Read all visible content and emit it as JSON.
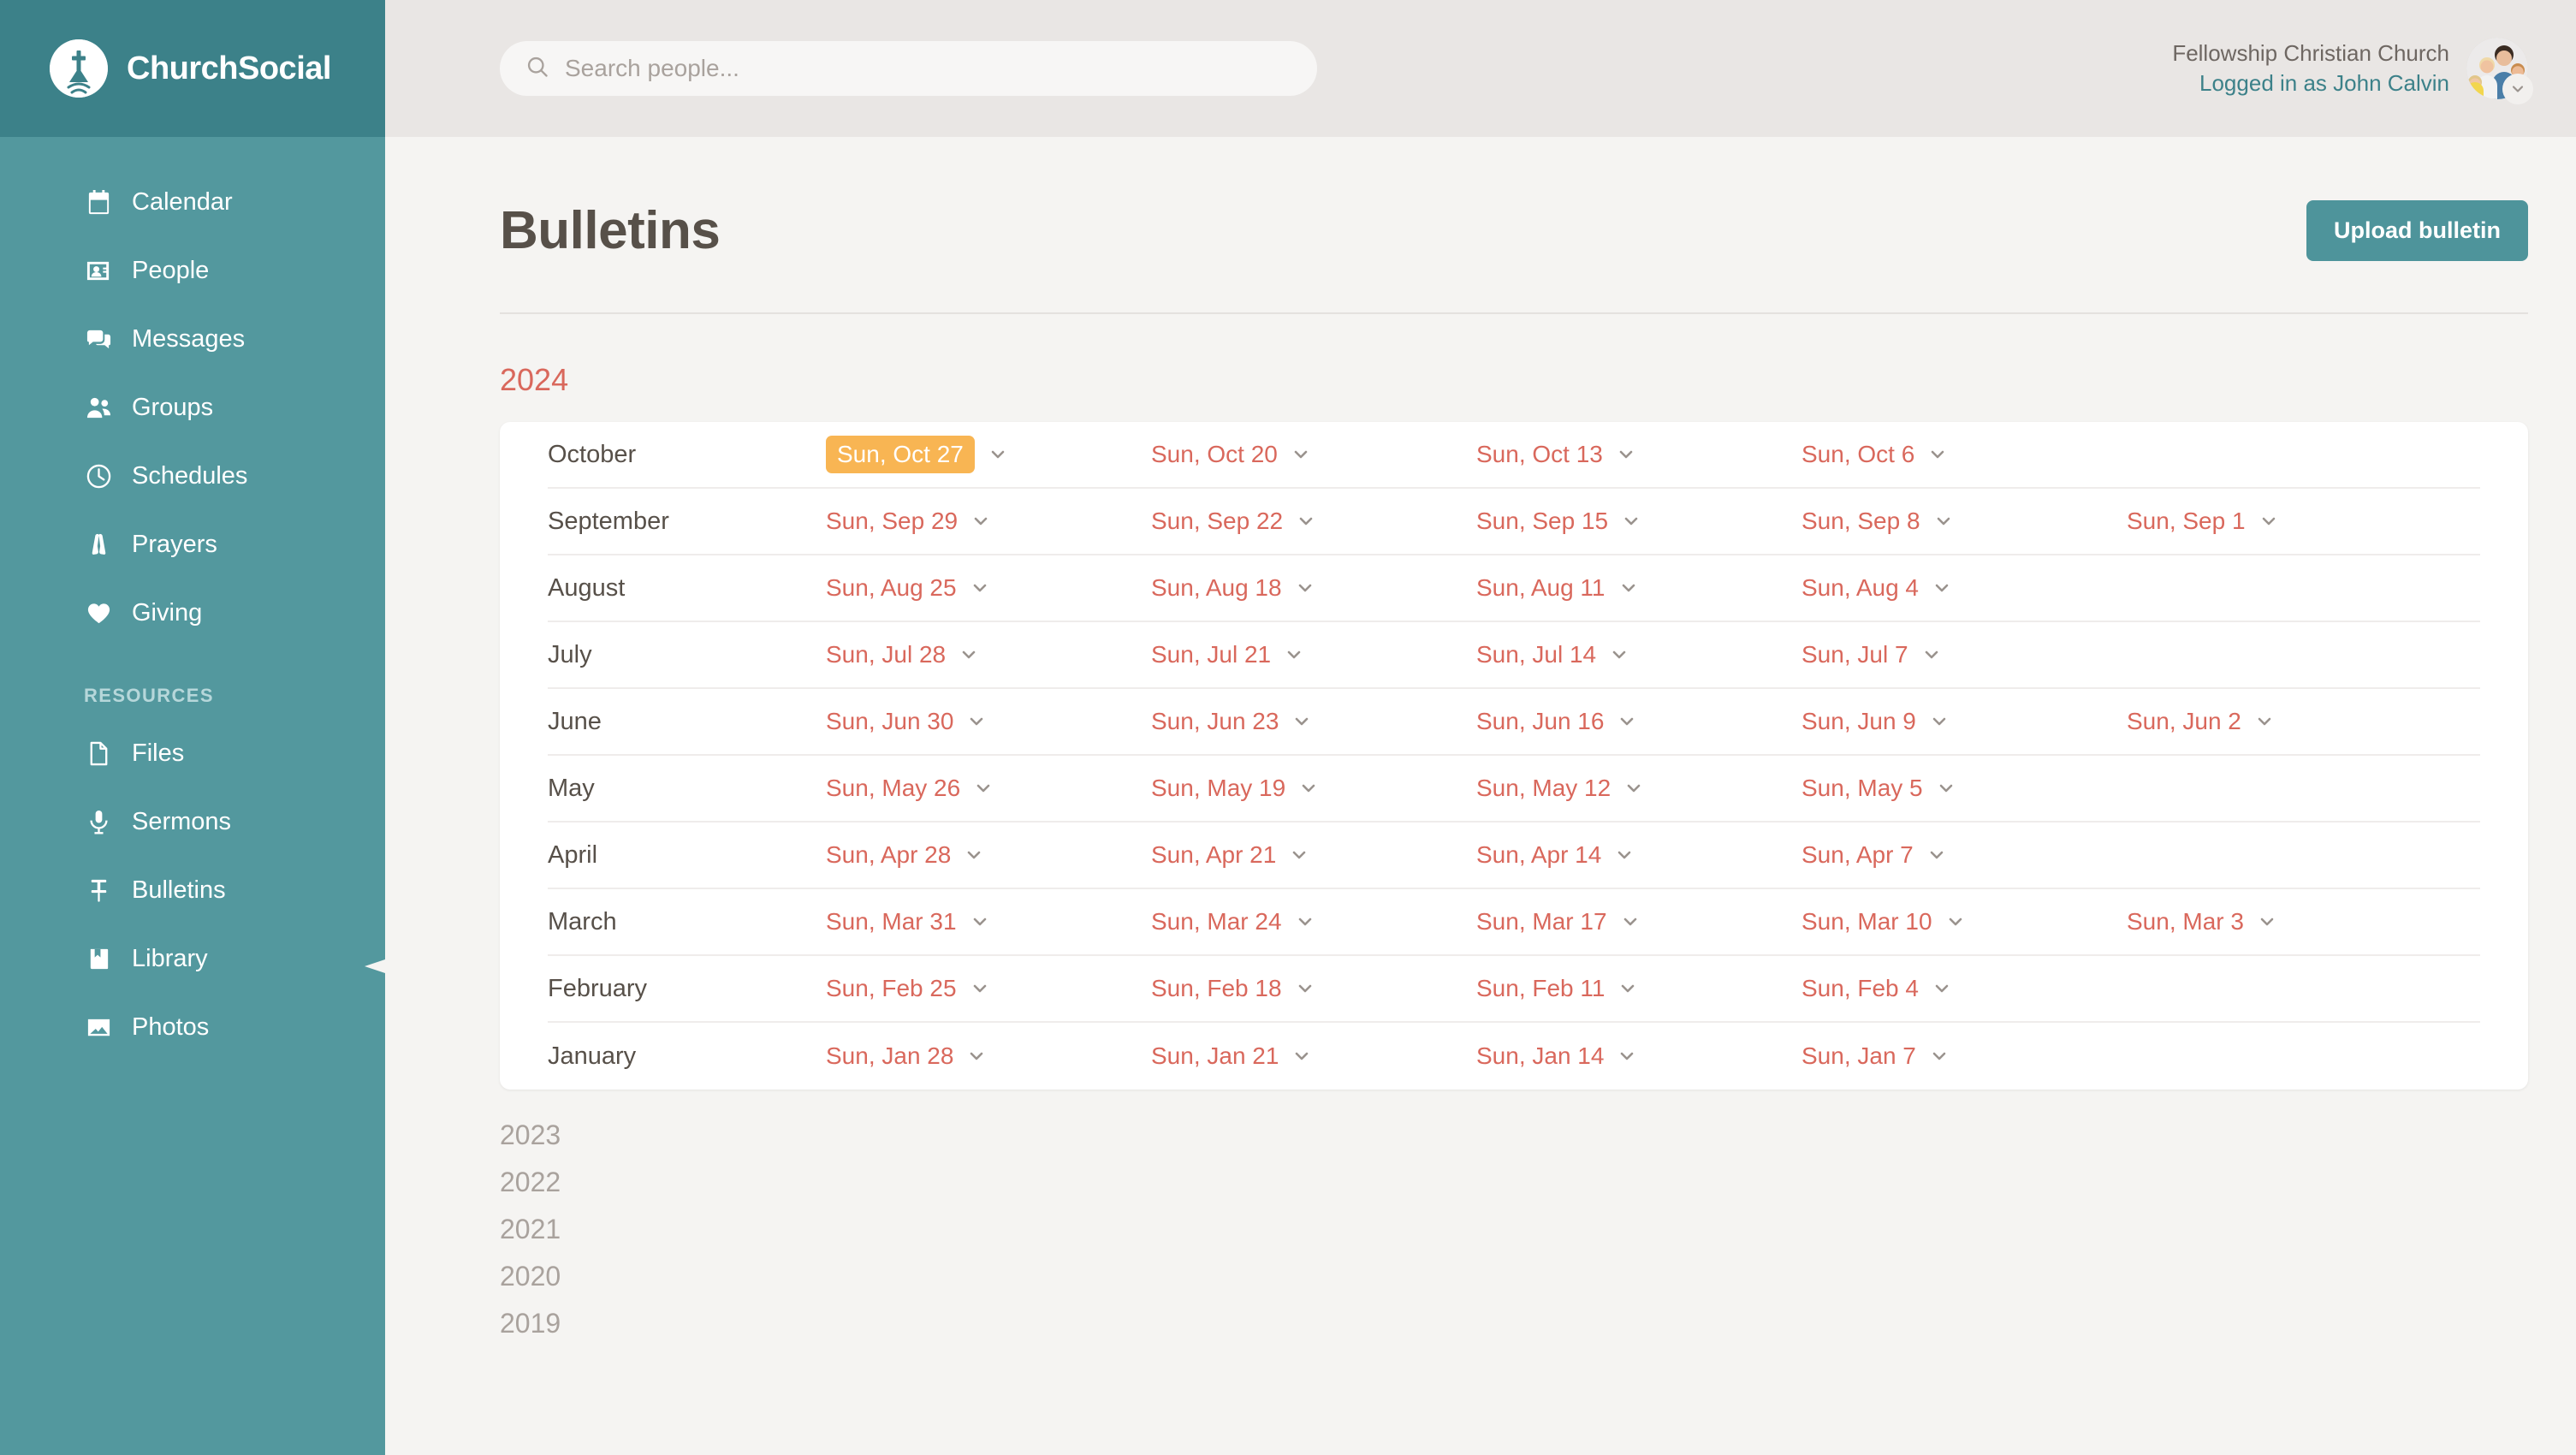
{
  "brand": {
    "name": "ChurchSocial",
    "logo_icon": "church-cross-logo-icon"
  },
  "sidebar": {
    "primary_items": [
      {
        "label": "Calendar",
        "icon": "calendar-icon"
      },
      {
        "label": "People",
        "icon": "people-card-icon"
      },
      {
        "label": "Messages",
        "icon": "messages-icon"
      },
      {
        "label": "Groups",
        "icon": "groups-icon"
      },
      {
        "label": "Schedules",
        "icon": "clock-icon"
      },
      {
        "label": "Prayers",
        "icon": "praying-hands-icon"
      },
      {
        "label": "Giving",
        "icon": "heart-icon"
      }
    ],
    "section_label": "RESOURCES",
    "resource_items": [
      {
        "label": "Files",
        "icon": "file-icon"
      },
      {
        "label": "Sermons",
        "icon": "microphone-icon"
      },
      {
        "label": "Bulletins",
        "icon": "pushpin-icon"
      },
      {
        "label": "Library",
        "icon": "book-icon"
      },
      {
        "label": "Photos",
        "icon": "photo-icon"
      }
    ],
    "active_item": "Bulletins"
  },
  "topbar": {
    "search_placeholder": "Search people...",
    "search_value": "",
    "search_icon": "search-icon",
    "church_name": "Fellowship Christian Church",
    "logged_in_as": "Logged in as John Calvin",
    "avatar_caret_icon": "chevron-down-icon"
  },
  "page": {
    "title": "Bulletins",
    "upload_label": "Upload bulletin"
  },
  "bulletins": {
    "current_year": "2024",
    "rows": [
      {
        "month": "October",
        "dates": [
          {
            "label": "Sun, Oct 27",
            "highlighted": true
          },
          {
            "label": "Sun, Oct 20"
          },
          {
            "label": "Sun, Oct 13"
          },
          {
            "label": "Sun, Oct 6"
          }
        ]
      },
      {
        "month": "September",
        "dates": [
          {
            "label": "Sun, Sep 29"
          },
          {
            "label": "Sun, Sep 22"
          },
          {
            "label": "Sun, Sep 15"
          },
          {
            "label": "Sun, Sep 8"
          },
          {
            "label": "Sun, Sep 1"
          }
        ]
      },
      {
        "month": "August",
        "dates": [
          {
            "label": "Sun, Aug 25"
          },
          {
            "label": "Sun, Aug 18"
          },
          {
            "label": "Sun, Aug 11"
          },
          {
            "label": "Sun, Aug 4"
          }
        ]
      },
      {
        "month": "July",
        "dates": [
          {
            "label": "Sun, Jul 28"
          },
          {
            "label": "Sun, Jul 21"
          },
          {
            "label": "Sun, Jul 14"
          },
          {
            "label": "Sun, Jul 7"
          }
        ]
      },
      {
        "month": "June",
        "dates": [
          {
            "label": "Sun, Jun 30"
          },
          {
            "label": "Sun, Jun 23"
          },
          {
            "label": "Sun, Jun 16"
          },
          {
            "label": "Sun, Jun 9"
          },
          {
            "label": "Sun, Jun 2"
          }
        ]
      },
      {
        "month": "May",
        "dates": [
          {
            "label": "Sun, May 26"
          },
          {
            "label": "Sun, May 19"
          },
          {
            "label": "Sun, May 12"
          },
          {
            "label": "Sun, May 5"
          }
        ]
      },
      {
        "month": "April",
        "dates": [
          {
            "label": "Sun, Apr 28"
          },
          {
            "label": "Sun, Apr 21"
          },
          {
            "label": "Sun, Apr 14"
          },
          {
            "label": "Sun, Apr 7"
          }
        ]
      },
      {
        "month": "March",
        "dates": [
          {
            "label": "Sun, Mar 31"
          },
          {
            "label": "Sun, Mar 24"
          },
          {
            "label": "Sun, Mar 17"
          },
          {
            "label": "Sun, Mar 10"
          },
          {
            "label": "Sun, Mar 3"
          }
        ]
      },
      {
        "month": "February",
        "dates": [
          {
            "label": "Sun, Feb 25"
          },
          {
            "label": "Sun, Feb 18"
          },
          {
            "label": "Sun, Feb 11"
          },
          {
            "label": "Sun, Feb 4"
          }
        ]
      },
      {
        "month": "January",
        "dates": [
          {
            "label": "Sun, Jan 28"
          },
          {
            "label": "Sun, Jan 21"
          },
          {
            "label": "Sun, Jan 14"
          },
          {
            "label": "Sun, Jan 7"
          }
        ]
      }
    ],
    "date_caret_icon": "chevron-down-icon",
    "other_years": [
      "2023",
      "2022",
      "2021",
      "2020",
      "2019"
    ]
  },
  "colors": {
    "sidebar": "#53989e",
    "brand_bar": "#3c8189",
    "accent_teal": "#4e949b",
    "date_red": "#d9685c",
    "highlight_amber": "#f8b553",
    "page_bg": "#f5f4f2",
    "topbar_bg": "#e9e6e4"
  }
}
